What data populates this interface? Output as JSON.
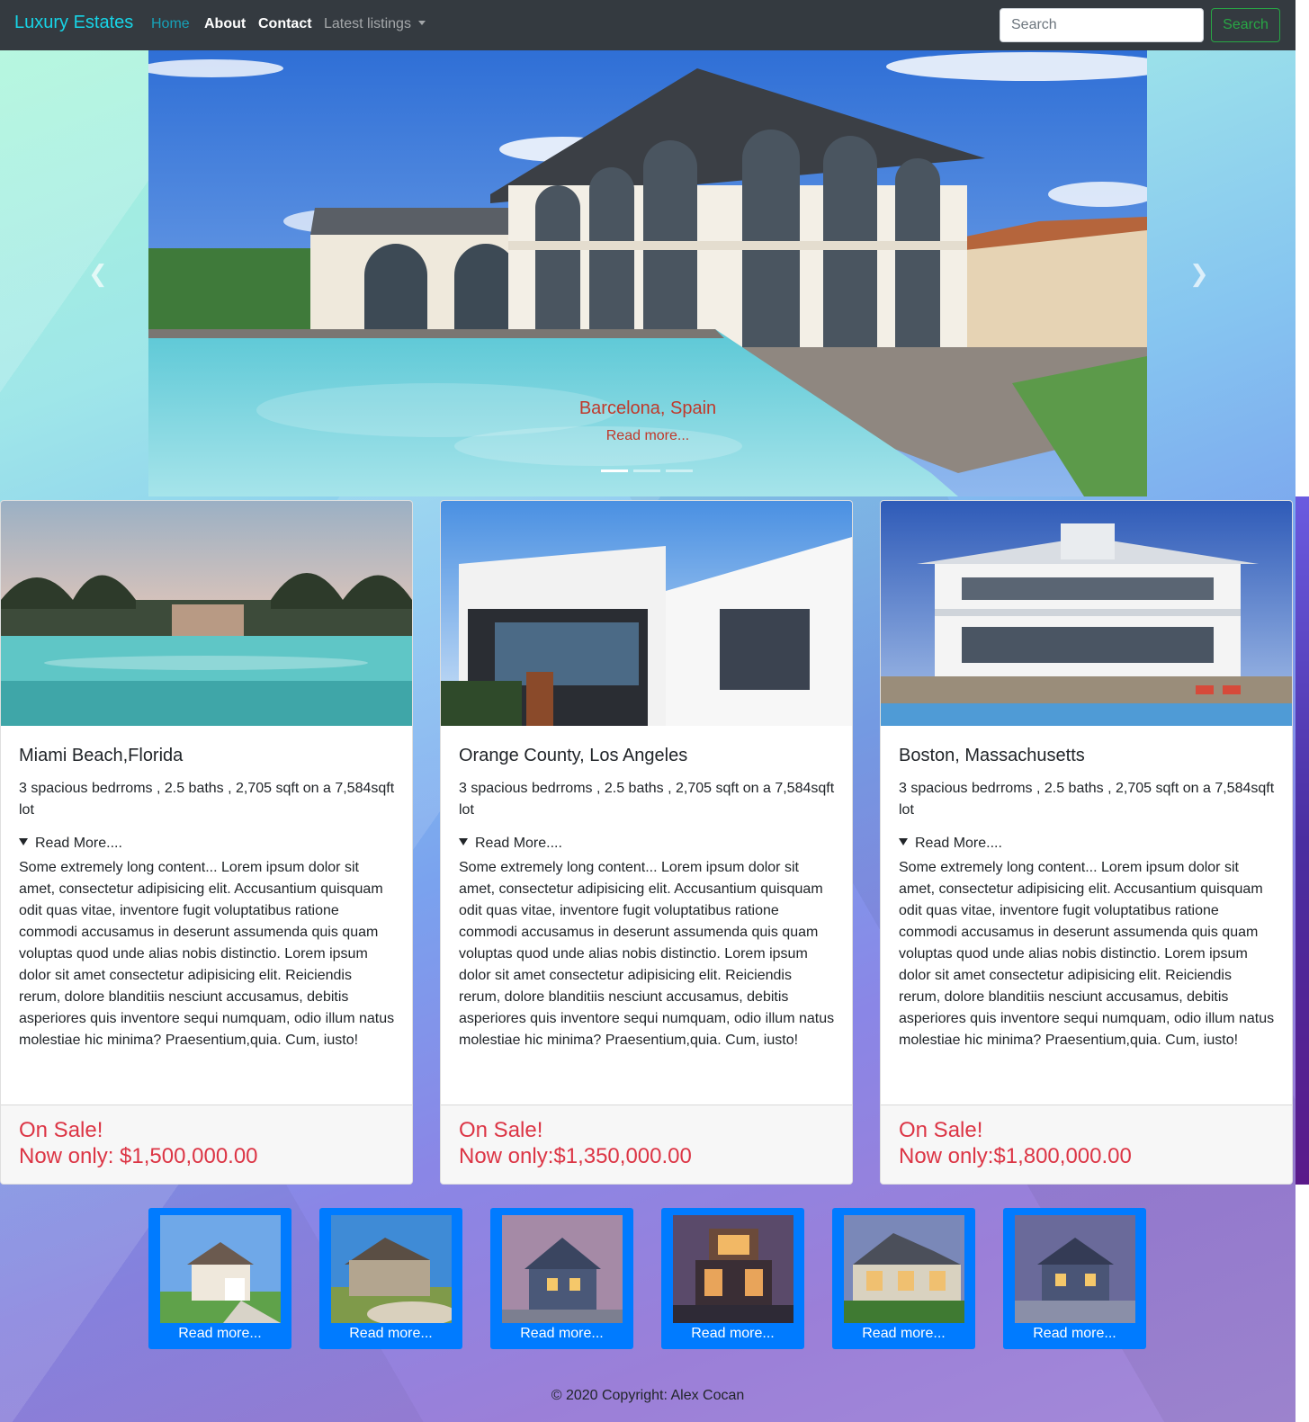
{
  "navbar": {
    "brand": "Luxury Estates",
    "links": [
      "Home",
      "About",
      "Contact"
    ],
    "dropdown_label": "Latest listings",
    "search_placeholder": "Search",
    "search_button": "Search"
  },
  "carousel": {
    "caption_title": "Barcelona, Spain",
    "caption_link": "Read more...",
    "slide_count": 3,
    "active_slide": 1
  },
  "cards": [
    {
      "title": "Miami Beach,Florida",
      "text": "3 spacious bedrroms , 2.5 baths , 2,705 sqft on a 7,584sqft lot",
      "summary": "Read More....",
      "details": "Some extremely long content... Lorem ipsum dolor sit amet, consectetur adipisicing elit. Accusantium quisquam odit quas vitae, inventore fugit voluptatibus ratione commodi accusamus in deserunt assumenda quis quam voluptas quod unde alias nobis distinctio. Lorem ipsum dolor sit amet consectetur adipisicing elit. Reiciendis rerum, dolore blanditiis nesciunt accusamus, debitis asperiores quis inventore sequi numquam, odio illum natus molestiae hic minima? Praesentium,quia. Cum, iusto!",
      "sale": "On Sale!",
      "price": "Now only: $1,500,000.00"
    },
    {
      "title": "Orange County, Los Angeles",
      "text": "3 spacious bedrroms , 2.5 baths , 2,705 sqft on a 7,584sqft lot",
      "summary": "Read More....",
      "details": "Some extremely long content... Lorem ipsum dolor sit amet, consectetur adipisicing elit. Accusantium quisquam odit quas vitae, inventore fugit voluptatibus ratione commodi accusamus in deserunt assumenda quis quam voluptas quod unde alias nobis distinctio. Lorem ipsum dolor sit amet consectetur adipisicing elit. Reiciendis rerum, dolore blanditiis nesciunt accusamus, debitis asperiores quis inventore sequi numquam, odio illum natus molestiae hic minima? Praesentium,quia. Cum, iusto!",
      "sale": "On Sale!",
      "price": "Now only:$1,350,000.00"
    },
    {
      "title": "Boston, Massachusetts",
      "text": "3 spacious bedrroms , 2.5 baths , 2,705 sqft on a 7,584sqft lot",
      "summary": "Read More....",
      "details": "Some extremely long content... Lorem ipsum dolor sit amet, consectetur adipisicing elit. Accusantium quisquam odit quas vitae, inventore fugit voluptatibus ratione commodi accusamus in deserunt assumenda quis quam voluptas quod unde alias nobis distinctio. Lorem ipsum dolor sit amet consectetur adipisicing elit. Reiciendis rerum, dolore blanditiis nesciunt accusamus, debitis asperiores quis inventore sequi numquam, odio illum natus molestiae hic minima? Praesentium,quia. Cum, iusto!",
      "sale": "On Sale!",
      "price": "Now only:$1,800,000.00"
    }
  ],
  "thumbnails": [
    "Read more...",
    "Read more...",
    "Read more...",
    "Read more...",
    "Read more...",
    "Read more..."
  ],
  "footer": "© 2020 Copyright: Alex Cocan",
  "colors": {
    "navbar_bg": "#343a40",
    "brand": "#17d4e6",
    "active_link": "#17a2b8",
    "search_button": "#28a745",
    "sale_text": "#dc3545",
    "thumb_bg": "#007bff",
    "caption": "#c0392b"
  }
}
